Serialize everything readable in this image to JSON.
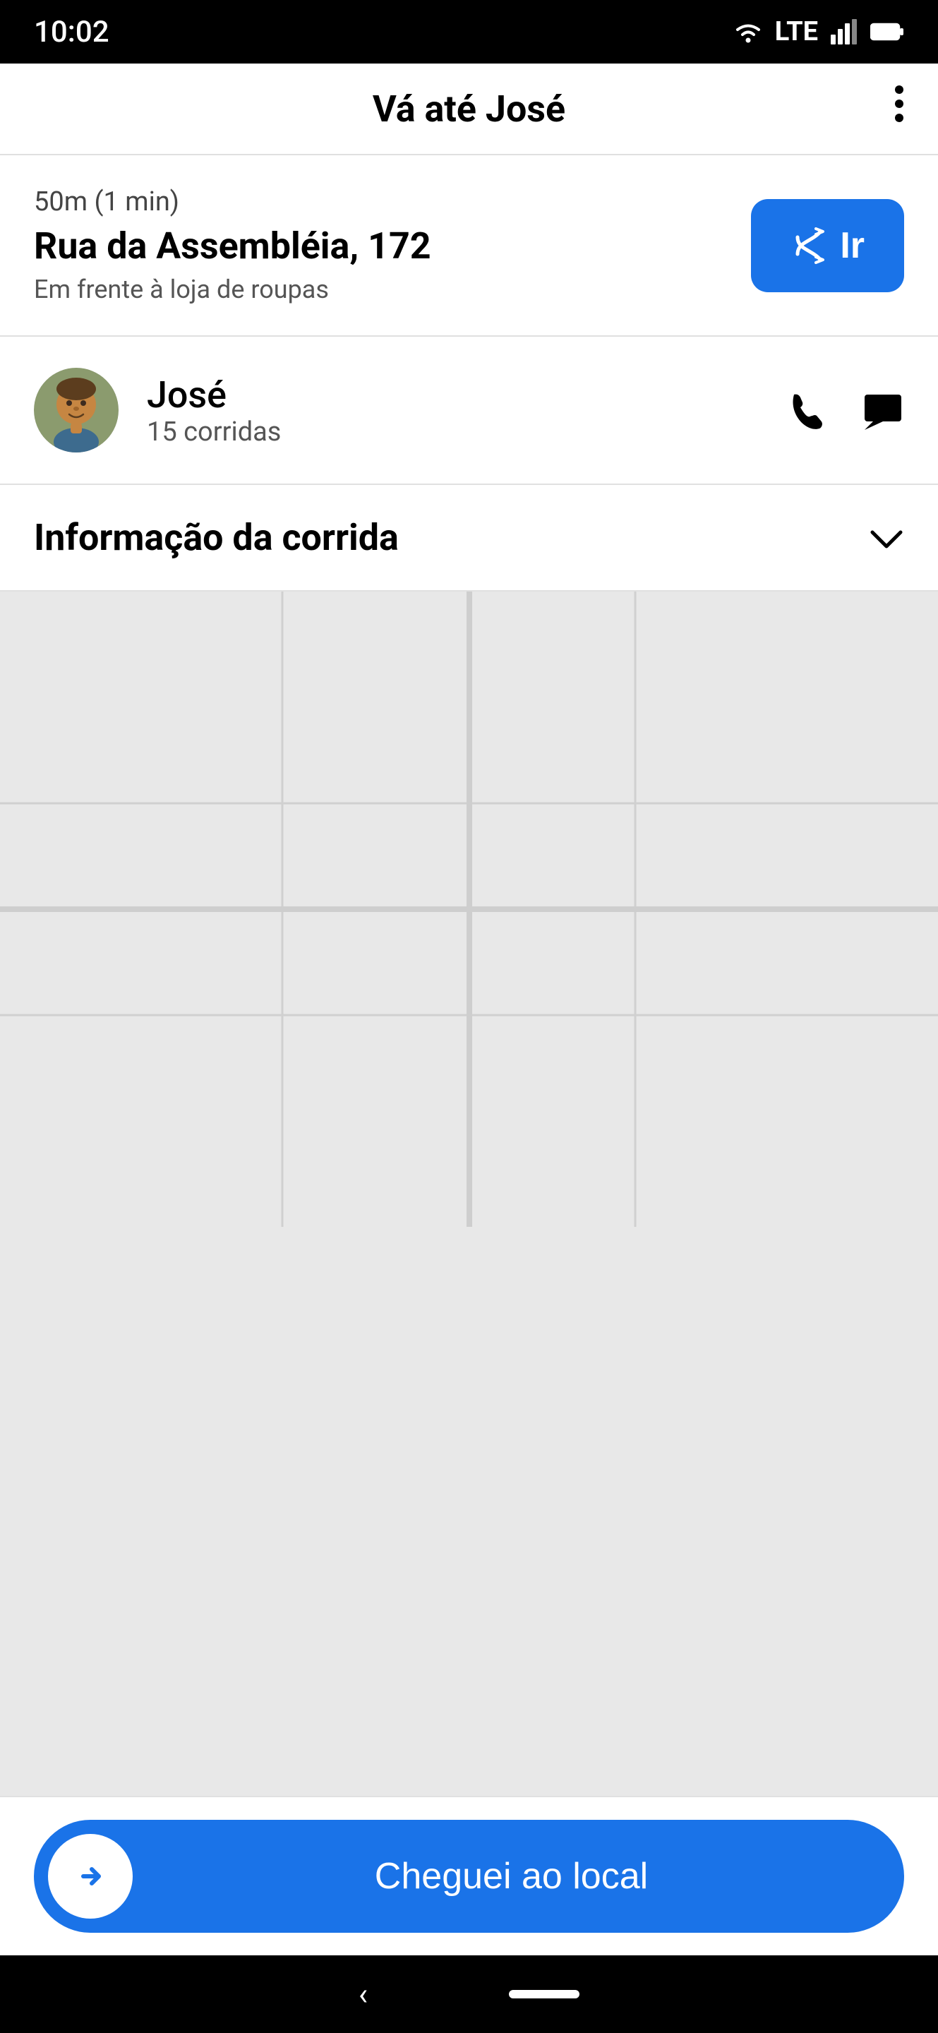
{
  "status_bar": {
    "time": "10:02",
    "signal": "LTE"
  },
  "app_bar": {
    "title": "Vá até José",
    "menu_icon": "more-vert-icon"
  },
  "destination": {
    "eta": "50m (1 min)",
    "address": "Rua da Assembléia, 172",
    "hint": "Em frente à loja de roupas",
    "go_button_label": "Ir"
  },
  "passenger": {
    "name": "José",
    "rides": "15 corridas",
    "phone_icon": "phone-icon",
    "message_icon": "message-icon"
  },
  "trip_info": {
    "label": "Informação da corrida",
    "chevron_icon": "chevron-down-icon"
  },
  "bottom": {
    "arrived_label": "Cheguei ao local",
    "arrow_icon": "arrow-right-icon"
  },
  "system_nav": {
    "back_icon": "back-icon"
  }
}
